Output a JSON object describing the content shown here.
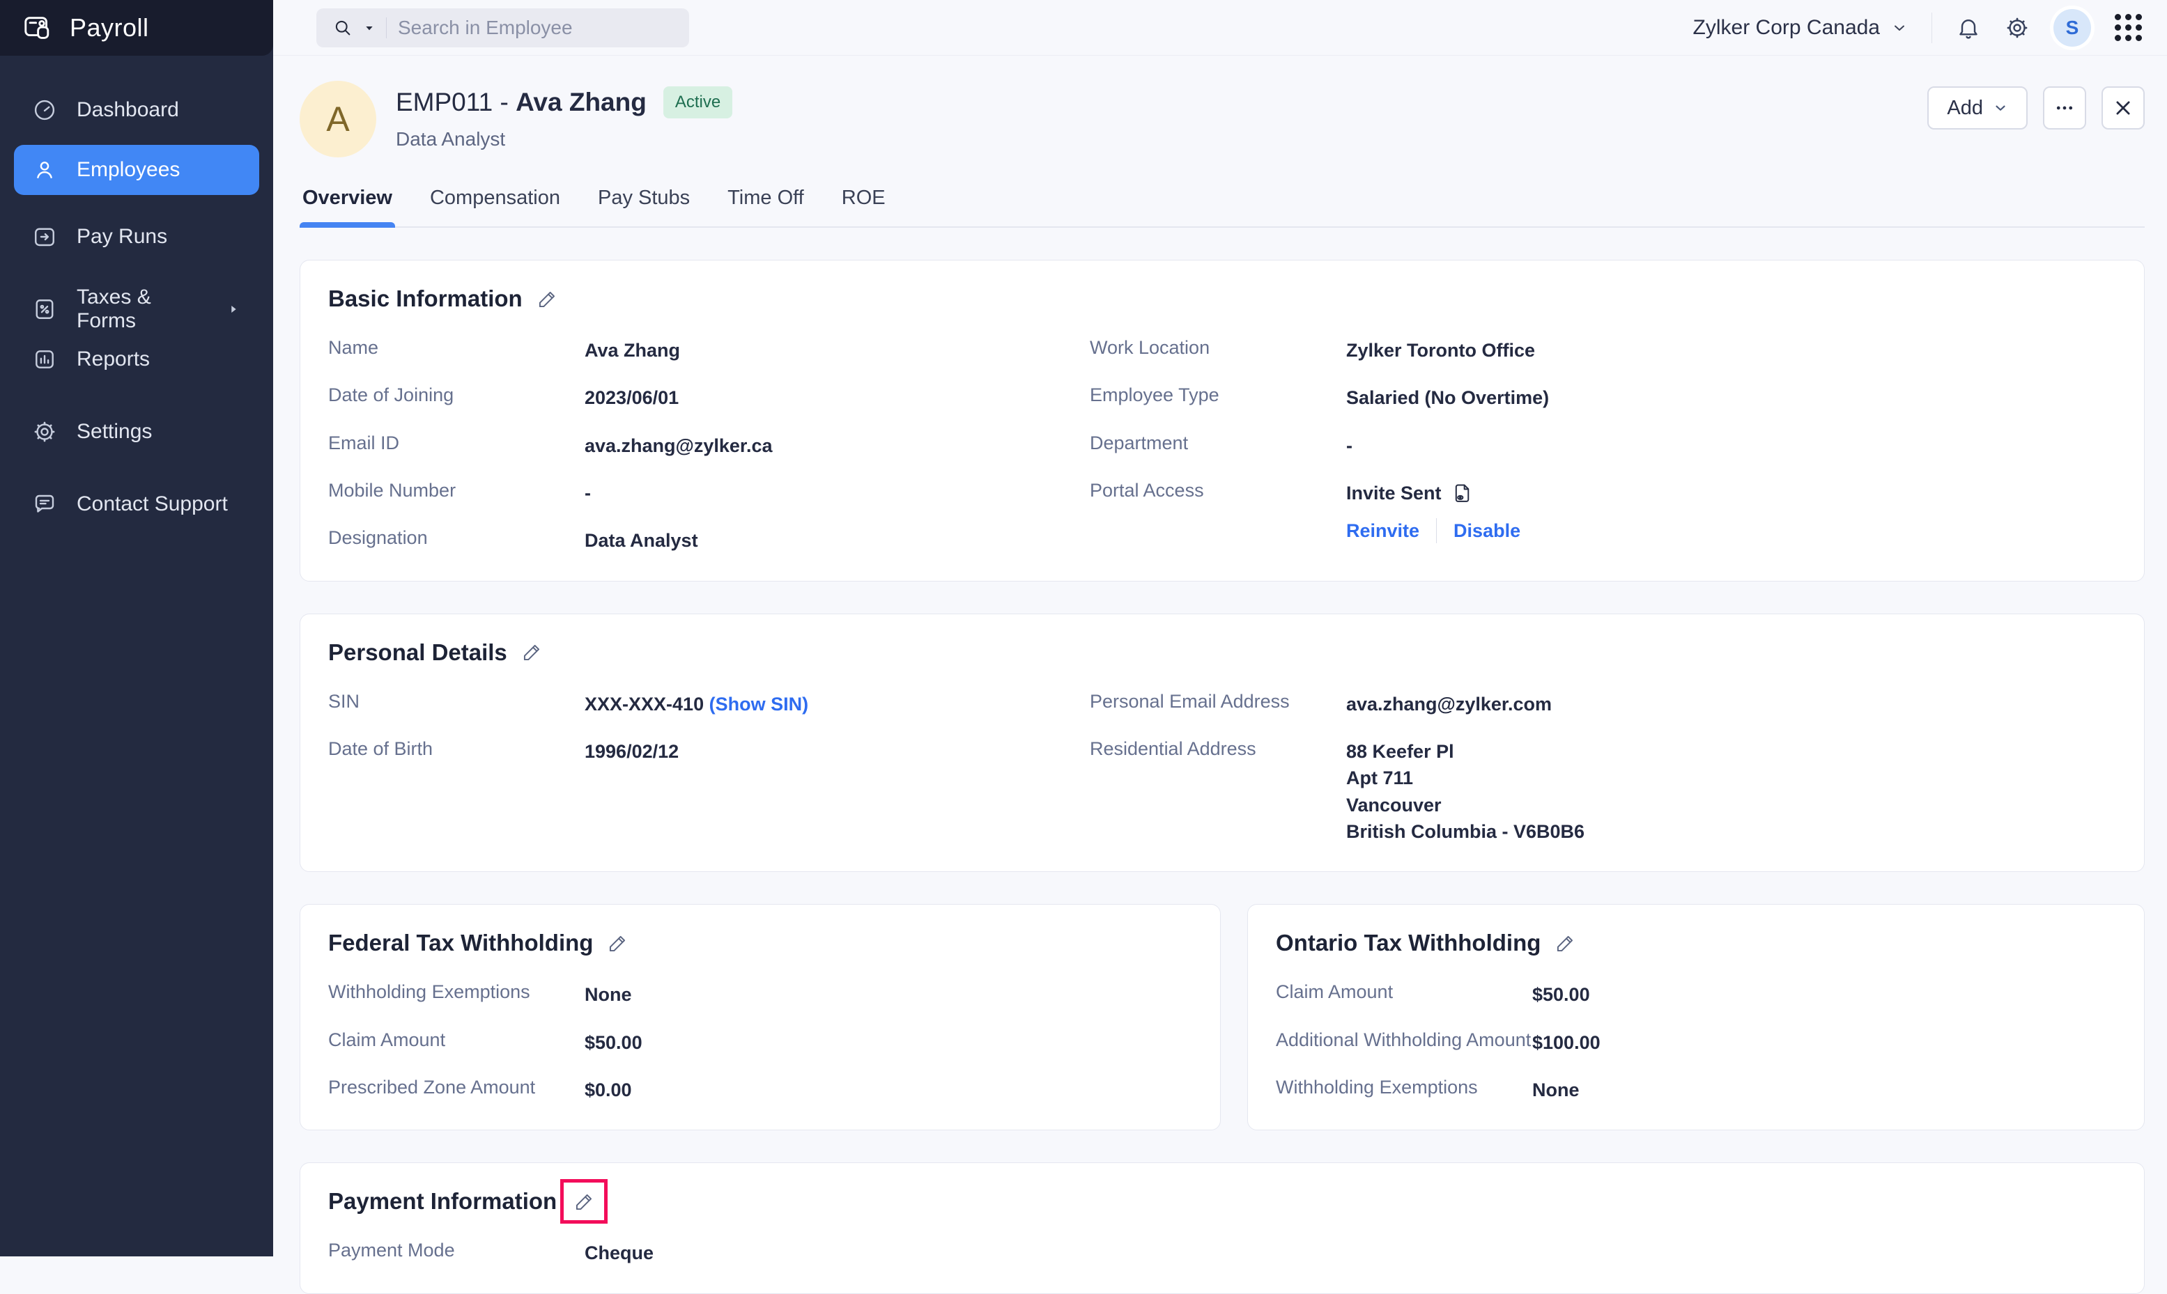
{
  "app": {
    "title": "Payroll"
  },
  "topbar": {
    "search_placeholder": "Search in Employee",
    "org_name": "Zylker Corp Canada",
    "avatar_initial": "S"
  },
  "sidebar": {
    "items": [
      {
        "label": "Dashboard",
        "active": false
      },
      {
        "label": "Employees",
        "active": true
      },
      {
        "label": "Pay Runs",
        "active": false
      },
      {
        "label": "Taxes & Forms",
        "active": false,
        "has_submenu": true
      },
      {
        "label": "Reports",
        "active": false
      },
      {
        "label": "Settings",
        "active": false
      },
      {
        "label": "Contact Support",
        "active": false
      }
    ]
  },
  "header": {
    "avatar_initial": "A",
    "employee_code": "EMP011 -",
    "employee_name": "Ava Zhang",
    "status_badge": "Active",
    "designation": "Data Analyst",
    "add_button": "Add"
  },
  "tabs": [
    {
      "label": "Overview",
      "active": true
    },
    {
      "label": "Compensation",
      "active": false
    },
    {
      "label": "Pay Stubs",
      "active": false
    },
    {
      "label": "Time Off",
      "active": false
    },
    {
      "label": "ROE",
      "active": false
    }
  ],
  "basic_information": {
    "title": "Basic Information",
    "left_rows": [
      {
        "label": "Name",
        "value": "Ava Zhang"
      },
      {
        "label": "Date of Joining",
        "value": "2023/06/01"
      },
      {
        "label": "Email ID",
        "value": "ava.zhang@zylker.ca"
      },
      {
        "label": "Mobile Number",
        "value": "-"
      },
      {
        "label": "Designation",
        "value": "Data Analyst"
      }
    ],
    "right_rows": [
      {
        "label": "Work Location",
        "value": "Zylker Toronto Office"
      },
      {
        "label": "Employee Type",
        "value": "Salaried (No Overtime)"
      },
      {
        "label": "Department",
        "value": "-"
      }
    ],
    "portal_access": {
      "label": "Portal Access",
      "status": "Invite Sent",
      "actions": [
        "Reinvite",
        "Disable"
      ]
    }
  },
  "personal_details": {
    "title": "Personal Details",
    "sin_label": "SIN",
    "sin_masked": "XXX-XXX-410",
    "show_sin_link": "(Show SIN)",
    "dob_label": "Date of Birth",
    "dob_value": "1996/02/12",
    "personal_email_label": "Personal Email Address",
    "personal_email_value": "ava.zhang@zylker.com",
    "residential_label": "Residential Address",
    "address_lines": [
      "88 Keefer Pl",
      "Apt 711",
      "Vancouver",
      "British Columbia - V6B0B6"
    ]
  },
  "federal_tax": {
    "title": "Federal Tax Withholding",
    "rows": [
      {
        "label": "Withholding Exemptions",
        "value": "None"
      },
      {
        "label": "Claim Amount",
        "value": "$50.00"
      },
      {
        "label": "Prescribed Zone Amount",
        "value": "$0.00"
      }
    ]
  },
  "ontario_tax": {
    "title": "Ontario Tax Withholding",
    "rows": [
      {
        "label": "Claim Amount",
        "value": "$50.00"
      },
      {
        "label": "Additional Withholding Amount",
        "value": "$100.00"
      },
      {
        "label": "Withholding Exemptions",
        "value": "None"
      }
    ]
  },
  "payment_information": {
    "title": "Payment Information",
    "rows": [
      {
        "label": "Payment Mode",
        "value": "Cheque"
      }
    ]
  },
  "icons": {
    "payroll-logo-icon": "wallet/card outline",
    "search-icon": "magnifier with dropdown caret",
    "notifications-bell-icon": "bell outline",
    "settings-gear-icon": "gear outline",
    "apps-grid-icon": "3x3 dot grid",
    "dashboard-icon": "speedometer",
    "employees-icon": "person",
    "pay-runs-icon": "calendar with arrow",
    "taxes-forms-icon": "document with percent",
    "reports-icon": "bar chart",
    "contact-support-icon": "chat bubble",
    "submenu-arrow-icon": "right triangle",
    "chevron-down-icon": "v chevron",
    "more-options-icon": "horizontal ellipsis",
    "close-icon": "x cross",
    "edit-pencil-icon": "pencil outline",
    "invite-sent-document-icon": "document with eye"
  },
  "colors": {
    "page_bg": "#F7F8FC",
    "sidebar_bg": "#232A40",
    "sidebar_header_bg": "#181C2D",
    "active_nav_bg": "#4187F5",
    "tab_underline": "#4584F2",
    "link_blue": "#2E6CF0",
    "status_active_bg": "#D7F0E2",
    "status_active_text": "#1E6E50",
    "employee_avatar_bg": "#FCEFD0",
    "employee_avatar_text": "#7F6729",
    "user_avatar_bg": "#D8E7FA",
    "user_avatar_text": "#2E6BD6",
    "annotation_highlight": "#F30D5A",
    "card_border": "#E5E7F0"
  }
}
